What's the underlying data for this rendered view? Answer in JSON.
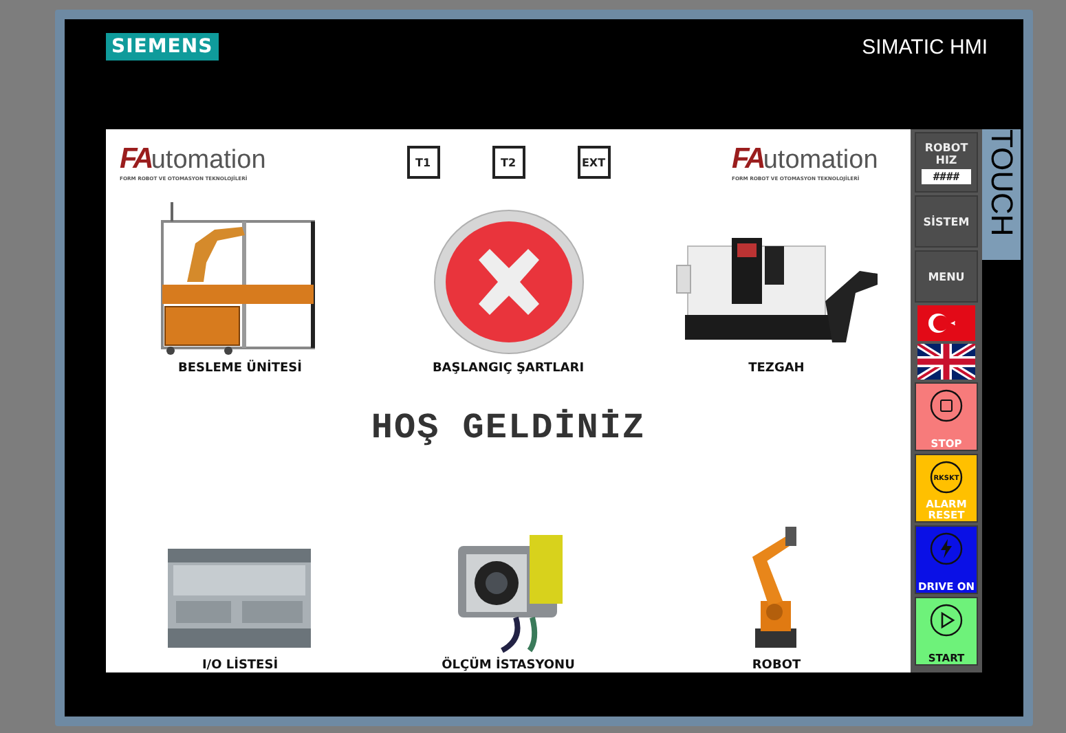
{
  "device": {
    "brand": "SIEMENS",
    "product": "SIMATIC HMI",
    "side_label": "TOUCH"
  },
  "screen": {
    "logos": [
      {
        "mark": "FA",
        "name": "utomation",
        "tagline": "FORM ROBOT VE OTOMASYON TEKNOLOJİLERİ"
      },
      {
        "mark": "FA",
        "name": "utomation",
        "tagline": "FORM ROBOT VE OTOMASYON TEKNOLOJİLERİ"
      }
    ],
    "top_buttons": [
      "T1",
      "T2",
      "EXT"
    ],
    "tiles": [
      {
        "kind": "cell",
        "label": "BESLEME ÜNİTESİ"
      },
      {
        "kind": "status",
        "label": "BAŞLANGIÇ ŞARTLARI"
      },
      {
        "kind": "lathe",
        "label": "TEZGAH"
      },
      {
        "kind": "plc",
        "label": "I/O LİSTESİ"
      },
      {
        "kind": "camera",
        "label": "ÖLÇÜM İSTASYONU"
      },
      {
        "kind": "robot",
        "label": "ROBOT"
      }
    ],
    "welcome": "HOŞ GELDİNİZ"
  },
  "sidebar": [
    {
      "kind": "speed",
      "label": "ROBOT HIZ",
      "value": "####"
    },
    {
      "kind": "nav",
      "label": "SİSTEM"
    },
    {
      "kind": "nav",
      "label": "MENU"
    },
    {
      "kind": "turkish"
    },
    {
      "kind": "english"
    },
    {
      "kind": "stop",
      "label": "STOP",
      "color": "#f77b7b"
    },
    {
      "kind": "reset",
      "icon_text": "RKSKT",
      "label": "ALARM RESET",
      "color": "#ffc000"
    },
    {
      "kind": "drive",
      "label": "DRIVE ON",
      "color": "#0a10e6"
    },
    {
      "kind": "start",
      "label": "START",
      "color": "#6ef27a"
    }
  ]
}
